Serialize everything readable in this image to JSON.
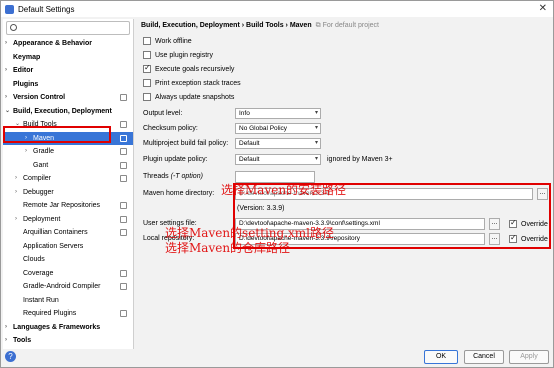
{
  "window": {
    "title": "Default Settings"
  },
  "search": {
    "placeholder": ""
  },
  "sidebar": {
    "items": [
      {
        "label": "Appearance & Behavior"
      },
      {
        "label": "Keymap"
      },
      {
        "label": "Editor"
      },
      {
        "label": "Plugins"
      },
      {
        "label": "Version Control"
      },
      {
        "label": "Build, Execution, Deployment"
      },
      {
        "label": "Build Tools"
      },
      {
        "label": "Maven"
      },
      {
        "label": "Gradle"
      },
      {
        "label": "Gant"
      },
      {
        "label": "Compiler"
      },
      {
        "label": "Debugger"
      },
      {
        "label": "Remote Jar Repositories"
      },
      {
        "label": "Deployment"
      },
      {
        "label": "Arquillian Containers"
      },
      {
        "label": "Application Servers"
      },
      {
        "label": "Clouds"
      },
      {
        "label": "Coverage"
      },
      {
        "label": "Gradle-Android Compiler"
      },
      {
        "label": "Instant Run"
      },
      {
        "label": "Required Plugins"
      },
      {
        "label": "Languages & Frameworks"
      },
      {
        "label": "Tools"
      }
    ]
  },
  "breadcrumb": {
    "path": "Build, Execution, Deployment › Build Tools › Maven",
    "note": "For default project"
  },
  "options": [
    {
      "label": "Work offline",
      "checked": false
    },
    {
      "label": "Use plugin registry",
      "checked": false
    },
    {
      "label": "Execute goals recursively",
      "checked": true
    },
    {
      "label": "Print exception stack traces",
      "checked": false
    },
    {
      "label": "Always update snapshots",
      "checked": false
    }
  ],
  "fields": {
    "output_level_label": "Output level:",
    "output_level_value": "Info",
    "checksum_label": "Checksum policy:",
    "checksum_value": "No Global Policy",
    "multiproject_label": "Multiproject build fail policy:",
    "multiproject_value": "Default",
    "plugin_update_label": "Plugin update policy:",
    "plugin_update_value": "Default",
    "plugin_update_note": "ignored by Maven 3+",
    "threads_label": "Threads",
    "threads_hint": "(-T option)",
    "maven_home_label": "Maven home directory:",
    "maven_home_value": "D:/devtool/apache-maven-3.3.9",
    "version_text": "(Version: 3.3.9)",
    "user_settings_label": "User settings file:",
    "user_settings_value": "D:\\devtool\\apache-maven-3.3.9\\conf\\settings.xml",
    "local_repo_label": "Local repository:",
    "local_repo_value": "D:\\devtool\\apache-maven-3.3.9\\repository",
    "override_label": "Override",
    "browse_label": "..."
  },
  "annotations": {
    "home": "选择Maven的安装路径",
    "settings": "选择Maven的setting.xml路径",
    "repo": "选择Maven的仓库路径"
  },
  "buttons": {
    "ok": "OK",
    "cancel": "Cancel",
    "apply": "Apply",
    "help": "?"
  }
}
